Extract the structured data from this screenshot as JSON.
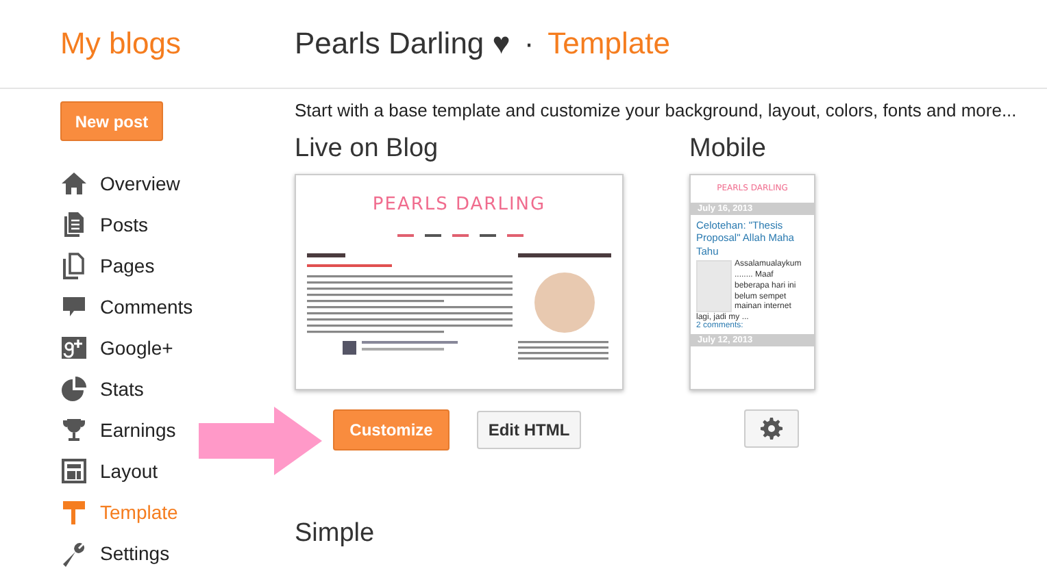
{
  "header": {
    "app_title": "My blogs",
    "blog_name": "Pearls Darling ♥",
    "separator": "·",
    "page": "Template"
  },
  "sidebar": {
    "new_post": "New post",
    "items": [
      {
        "label": "Overview",
        "selected": false
      },
      {
        "label": "Posts",
        "selected": false
      },
      {
        "label": "Pages",
        "selected": false
      },
      {
        "label": "Comments",
        "selected": false
      },
      {
        "label": "Google+",
        "selected": false
      },
      {
        "label": "Stats",
        "selected": false
      },
      {
        "label": "Earnings",
        "selected": false
      },
      {
        "label": "Layout",
        "selected": false
      },
      {
        "label": "Template",
        "selected": true
      },
      {
        "label": "Settings",
        "selected": false
      }
    ]
  },
  "intro": "Start with a base template and customize your background, layout, colors, fonts and more...",
  "live": {
    "heading": "Live on Blog",
    "preview_title": "PEARLS DARLING",
    "buttons": [
      "Customize",
      "Edit HTML"
    ]
  },
  "mobile": {
    "heading": "Mobile",
    "preview_title": "PEARLS DARLING",
    "posts": [
      {
        "date": "July 16, 2013",
        "title": "Celotehan: \"Thesis Proposal\" Allah Maha Tahu",
        "excerpt": "Assalamualaykum ........ Maaf beberapa hari ini belum sempet mainan internet",
        "excerpt_tail": "lagi, jadi my ...",
        "comments": "2 comments:"
      },
      {
        "date": "July 12, 2013"
      }
    ]
  },
  "next_section": "Simple"
}
